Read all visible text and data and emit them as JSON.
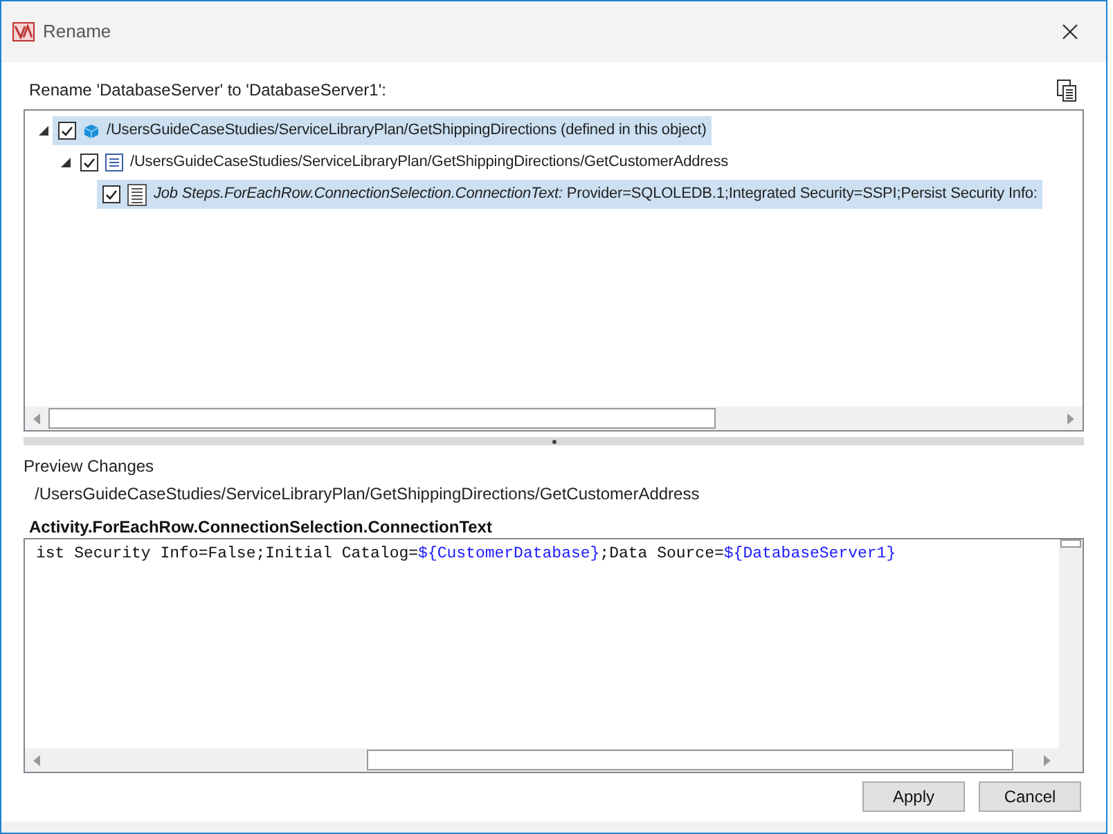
{
  "window": {
    "title": "Rename"
  },
  "prompt": "Rename 'DatabaseServer' to 'DatabaseServer1':",
  "tree": [
    {
      "label": "/UsersGuideCaseStudies/ServiceLibraryPlan/GetShippingDirections (defined in this object)",
      "kind": "object",
      "checked": true,
      "expanded": true,
      "selected": true,
      "children": [
        {
          "label": "/UsersGuideCaseStudies/ServiceLibraryPlan/GetShippingDirections/GetCustomerAddress",
          "kind": "activity",
          "checked": true,
          "expanded": true,
          "selected": false,
          "children": [
            {
              "label": "*Job Steps.ForEachRow.ConnectionSelection.ConnectionText:* Provider=SQLOLEDB.1;Integrated Security=SSPI;Persist Security Info:",
              "kind": "property",
              "checked": true,
              "selected": true
            }
          ]
        }
      ]
    }
  ],
  "preview": {
    "heading": "Preview Changes",
    "path": "/UsersGuideCaseStudies/ServiceLibraryPlan/GetShippingDirections/GetCustomerAddress",
    "property": "Activity.ForEachRow.ConnectionSelection.ConnectionText",
    "text": [
      {
        "kind": "literal",
        "text": "ist Security Info=False;Initial Catalog="
      },
      {
        "kind": "variable",
        "text": "${CustomerDatabase}"
      },
      {
        "kind": "literal",
        "text": ";Data Source="
      },
      {
        "kind": "variable",
        "text": "${DatabaseServer1}"
      }
    ]
  },
  "buttons": [
    "Apply",
    "Cancel"
  ]
}
